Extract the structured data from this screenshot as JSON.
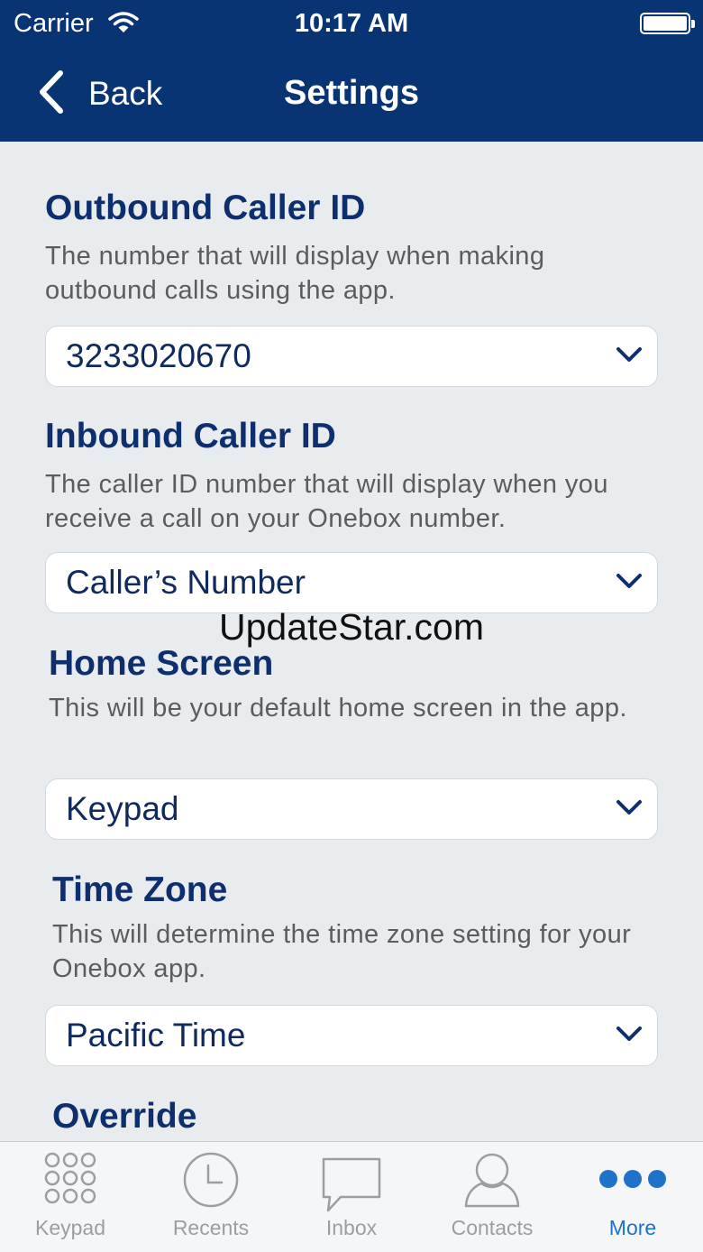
{
  "status": {
    "carrier": "Carrier",
    "time": "10:17 AM"
  },
  "nav": {
    "back_label": "Back",
    "title": "Settings"
  },
  "sections": [
    {
      "title": "Outbound Caller ID",
      "description": "The number that will display when making outbound calls using the app.",
      "value": "3233020670"
    },
    {
      "title": "Inbound Caller ID",
      "description": "The caller ID number that will display when you receive a call on your Onebox number.",
      "value": "Caller’s Number"
    },
    {
      "title": "Home Screen",
      "description": "This will be your default home screen in the app.",
      "value": "Keypad"
    },
    {
      "title": "Time Zone",
      "description": "This will determine the time zone setting for your Onebox app.",
      "value": "Pacific Time"
    },
    {
      "title": "Override"
    }
  ],
  "watermark": "UpdateStar.com",
  "tabs": [
    {
      "label": "Keypad",
      "icon": "keypad-icon",
      "active": false
    },
    {
      "label": "Recents",
      "icon": "clock-icon",
      "active": false
    },
    {
      "label": "Inbox",
      "icon": "chat-bubble-icon",
      "active": false
    },
    {
      "label": "Contacts",
      "icon": "person-icon",
      "active": false
    },
    {
      "label": "More",
      "icon": "more-dots-icon",
      "active": true
    }
  ],
  "colors": {
    "header": "#093474",
    "section_title": "#0d2f6e",
    "accent": "#1e73c8",
    "tab_inactive": "#9b9ea3",
    "background": "#e9ecef"
  }
}
